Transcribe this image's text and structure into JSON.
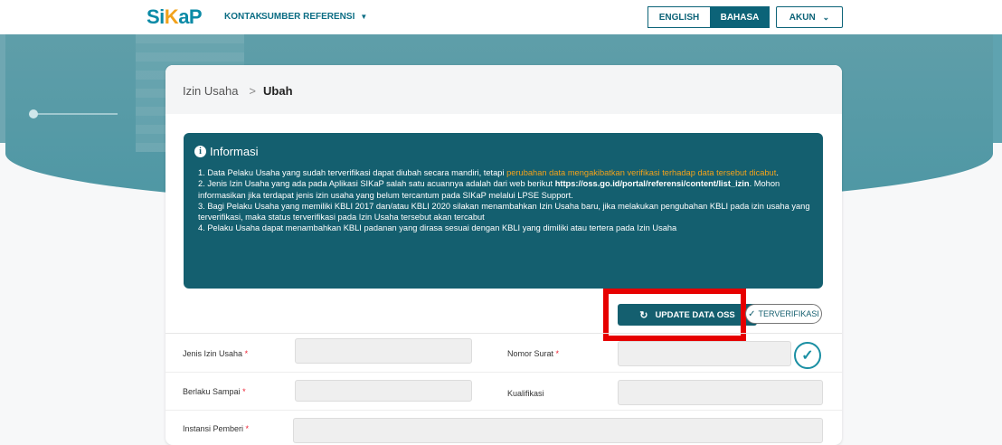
{
  "header": {
    "logo_main": "Si",
    "logo_accent": "K",
    "logo_end": "aP",
    "nav_kontak": "KONTAK",
    "nav_sumber": "SUMBER REFERENSI",
    "lang_english": "ENGLISH",
    "lang_bahasa": "BAHASA",
    "akun": "AKUN"
  },
  "breadcrumb": {
    "parent": "Izin Usaha",
    "separator": ">",
    "current": "Ubah"
  },
  "info": {
    "title": "Informasi",
    "item1_pre": "1. Data Pelaku Usaha yang sudah terverifikasi dapat diubah secara mandiri, tetapi ",
    "item1_orange": "perubahan data mengakibatkan verifikasi terhadap data tersebut dicabut",
    "item1_post": ".",
    "item2_pre": "2. Jenis Izin Usaha yang ada pada Aplikasi SIKaP salah satu acuannya adalah dari web berikut ",
    "item2_link": "https://oss.go.id/portal/referensi/content/list_izin",
    "item2_post": ". Mohon informasikan jika terdapat jenis izin usaha yang belum tercantum pada SIKaP melalui LPSE Support.",
    "item3": "3. Bagi Pelaku Usaha yang memiliki KBLI 2017 dan/atau KBLI 2020 silakan menambahkan Izin Usaha baru, jika melakukan pengubahan KBLI pada izin usaha yang terverifikasi, maka status terverifikasi pada Izin Usaha tersebut akan tercabut",
    "item4": "4. Pelaku Usaha dapat menambahkan KBLI padanan yang dirasa sesuai dengan KBLI yang dimiliki atau tertera pada Izin Usaha"
  },
  "actions": {
    "update_label": "UPDATE DATA OSS",
    "verified_label": "TERVERIFIKASI"
  },
  "form": {
    "jenis_izin": "Jenis Izin Usaha",
    "nomor_surat": "Nomor Surat",
    "berlaku_sampai": "Berlaku Sampai",
    "kualifikasi": "Kualifikasi",
    "instansi_pemberi": "Instansi Pemberi",
    "required_mark": "*"
  },
  "colors": {
    "primary": "#145f6f",
    "accent_orange": "#f2a21b",
    "highlight_red": "#e60000"
  },
  "icons": {
    "info": "info-icon",
    "refresh": "refresh-icon",
    "check": "check-icon",
    "verified_badge": "check-circle-icon",
    "caret": "caret-down-icon",
    "chevron": "chevron-down-icon"
  }
}
